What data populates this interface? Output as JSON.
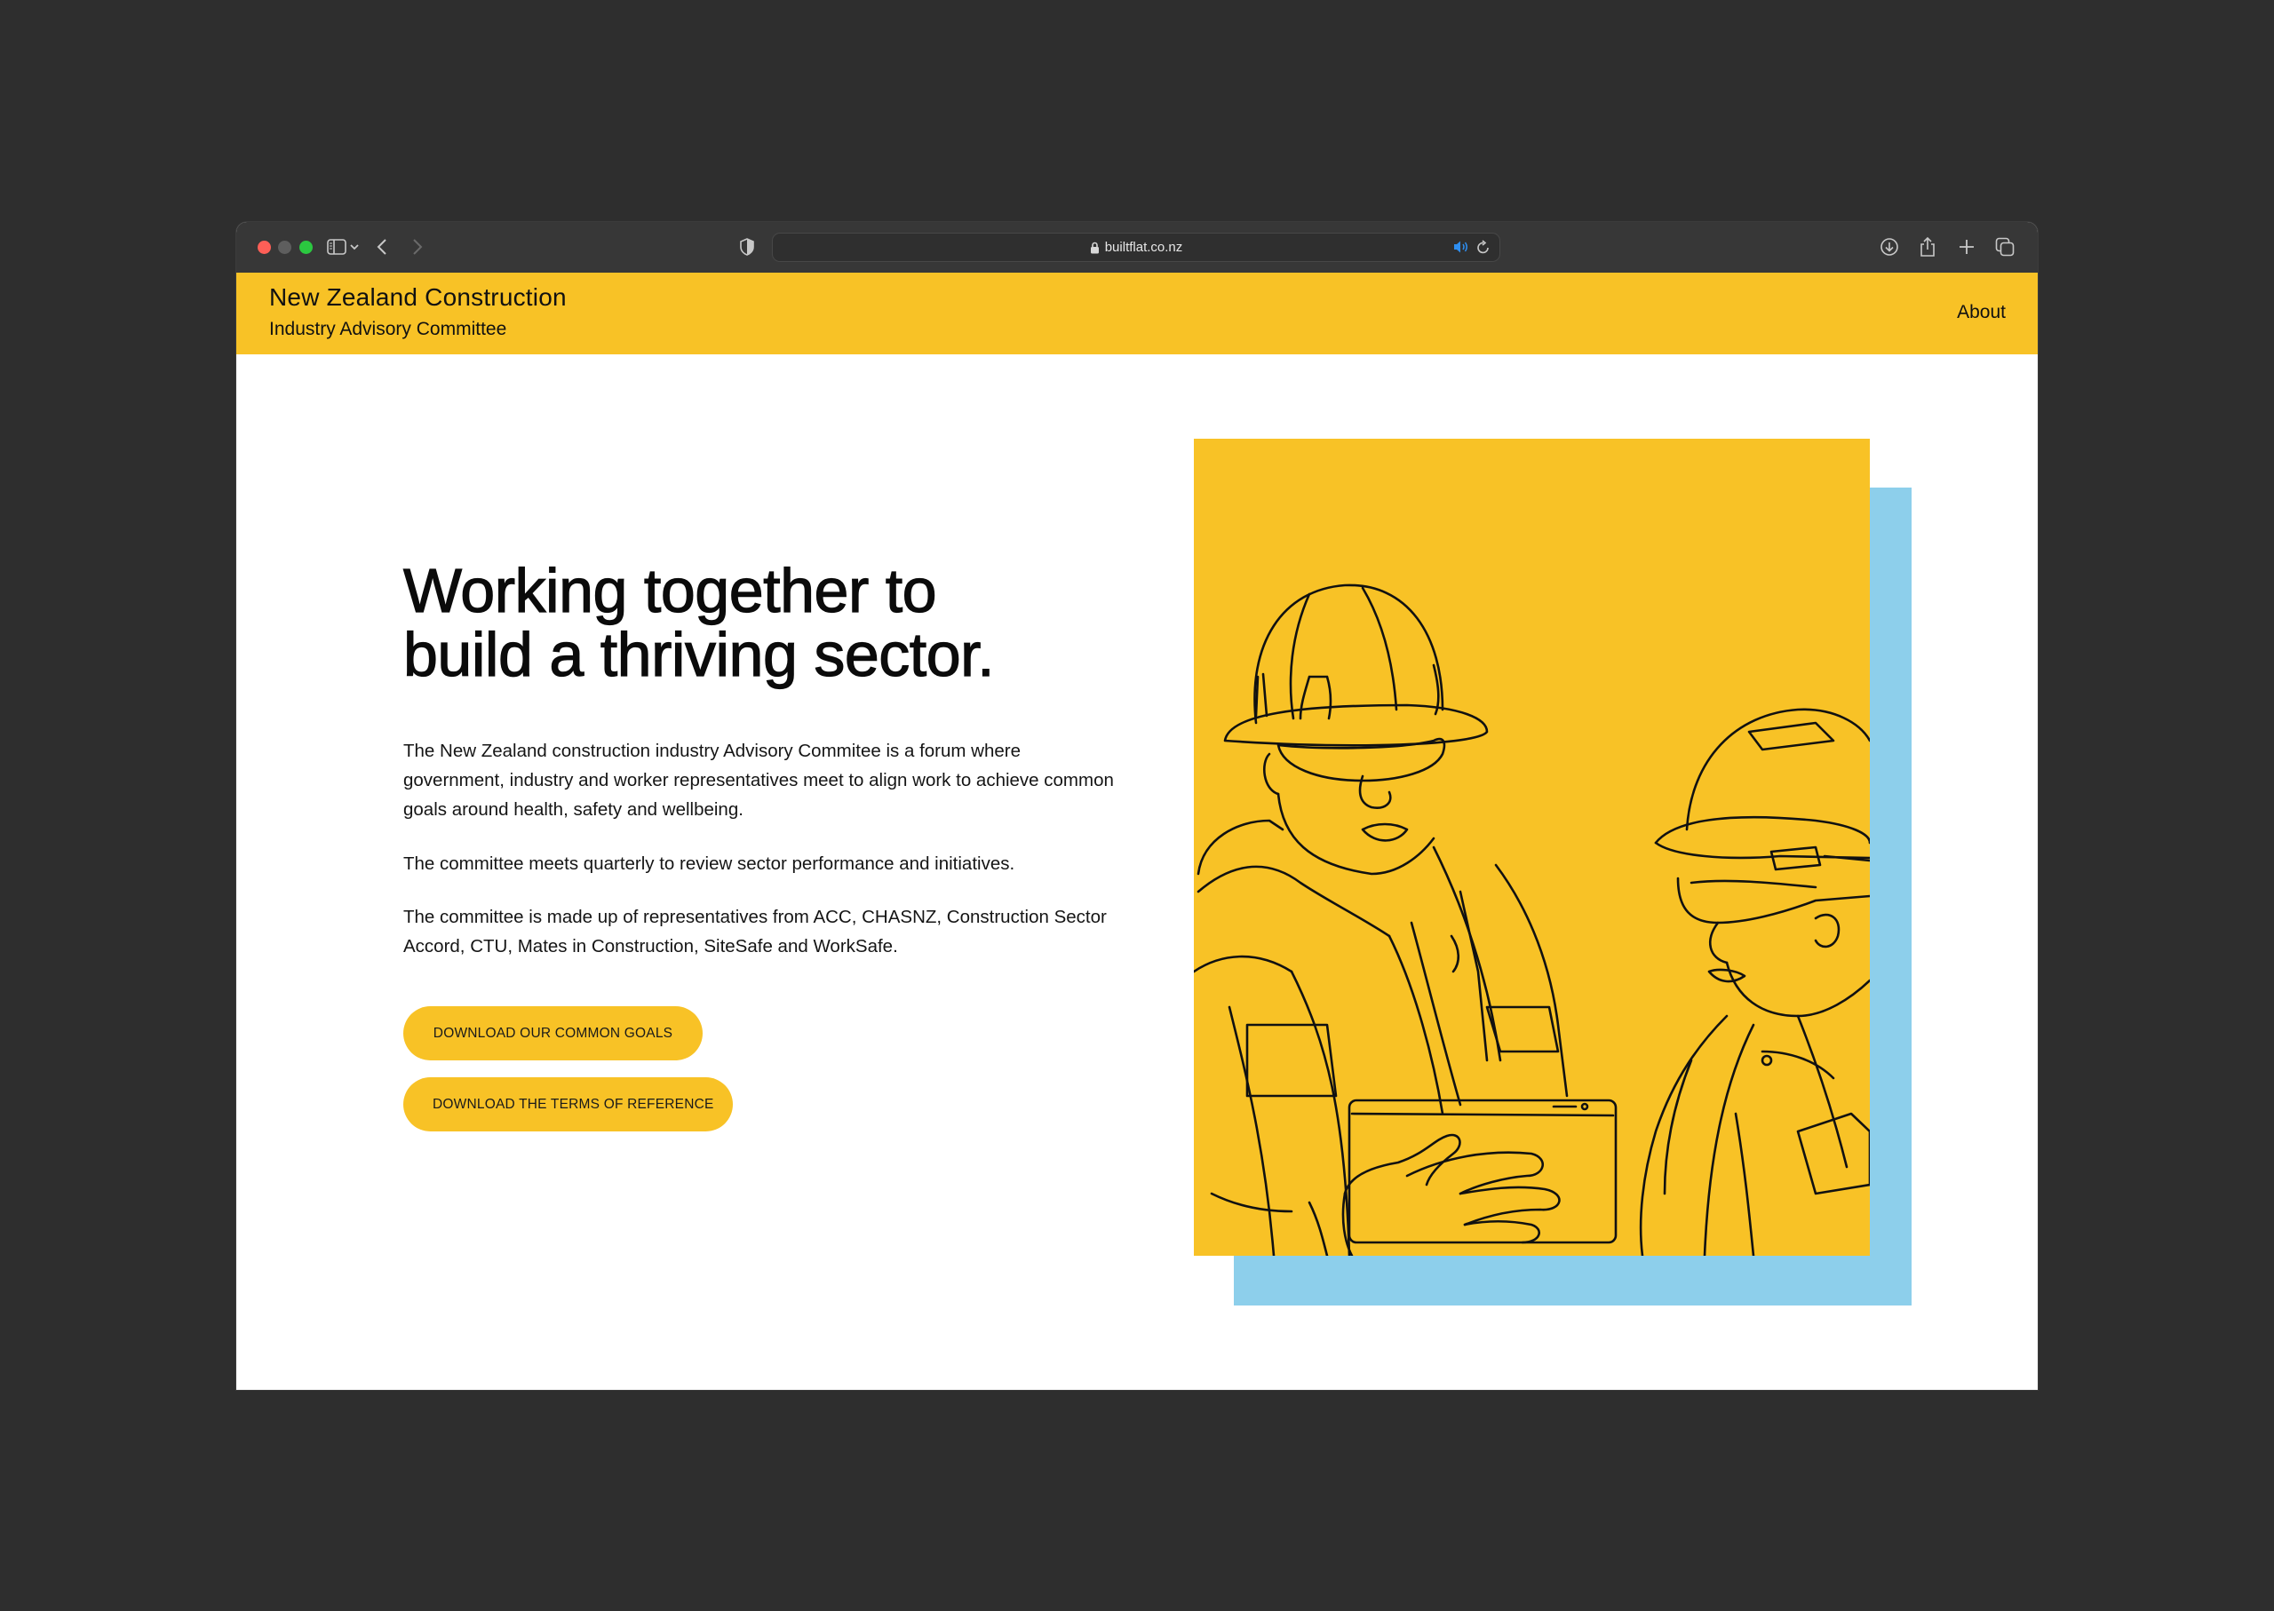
{
  "browser": {
    "url": "builtflat.co.nz",
    "toolbar_icons": [
      "sidebar-icon",
      "chevron-down-icon",
      "back-icon",
      "forward-icon",
      "privacy-shield-icon",
      "lock-icon",
      "audio-playing-icon",
      "reload-icon",
      "download-icon",
      "share-icon",
      "new-tab-icon",
      "tab-overview-icon"
    ]
  },
  "header": {
    "title": "New Zealand Construction",
    "subtitle": "Industry Advisory Committee",
    "nav": [
      {
        "label": "About"
      }
    ]
  },
  "hero": {
    "heading_line1": "Working together to",
    "heading_line2": "build a thriving sector.",
    "paragraphs": [
      "The New Zealand construction industry Advisory Commitee is a forum where government, industry and worker representatives meet to align work to achieve common goals around health, safety and wellbeing.",
      "The committee meets quarterly to review sector performance and initiatives.",
      "The committee is made up of representatives from ACC, CHASNZ, Construction Sector Accord, CTU, Mates in Construction, SiteSafe and WorkSafe."
    ],
    "buttons": [
      {
        "label": "DOWNLOAD OUR COMMON GOALS"
      },
      {
        "label": "DOWNLOAD THE TERMS OF REFERENCE"
      }
    ]
  },
  "illustration": {
    "description": "Line drawing of two construction workers in hard hats and safety glasses looking at a tablet",
    "colors": {
      "panel": "#f8c226",
      "shadow_panel": "#8dcfeb",
      "line": "#111111"
    }
  },
  "theme": {
    "accent": "#f8c226",
    "secondary": "#8dcfeb",
    "background": "#2e2e2e",
    "chrome": "#373737"
  }
}
